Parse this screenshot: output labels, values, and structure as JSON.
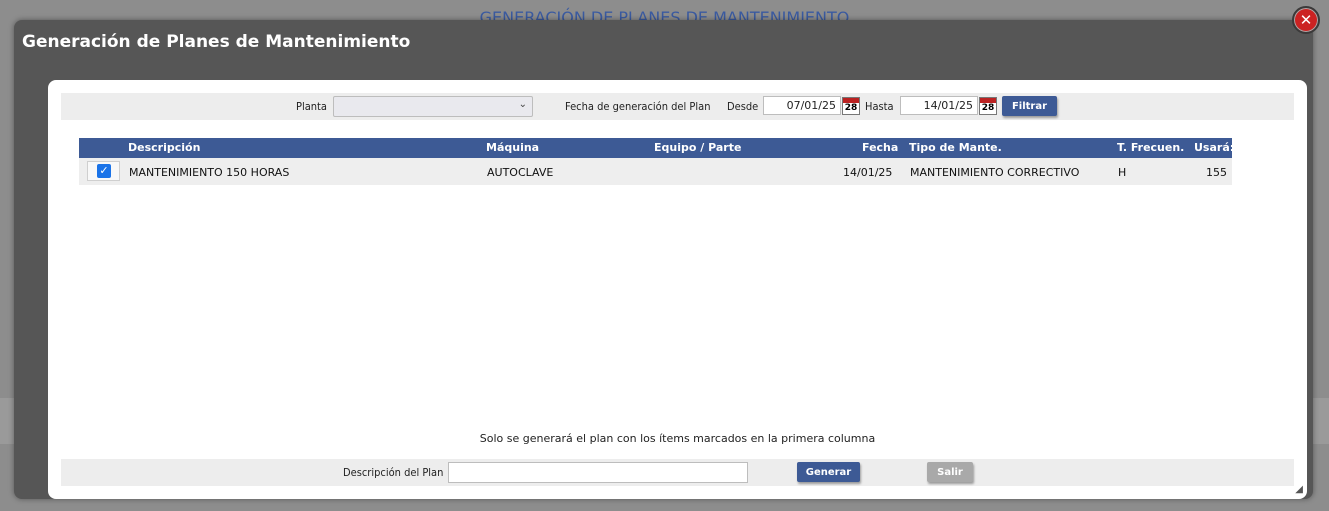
{
  "background": {
    "title": "GENERACIÓN DE PLANES DE MANTENIMIENTO"
  },
  "dialog": {
    "title": "Generación de Planes de Mantenimiento",
    "close_icon": "close-icon",
    "close_symbol": "✕"
  },
  "filters": {
    "planta_label": "Planta",
    "planta_value": "",
    "fecha_label": "Fecha de generación del Plan",
    "desde_label": "Desde",
    "desde_value": "07/01/25",
    "hasta_label": "Hasta",
    "hasta_value": "14/01/25",
    "calendar_icon": "calendar-icon",
    "calendar_day": "28",
    "filtrar_label": "Filtrar"
  },
  "table": {
    "headers": {
      "descripcion": "Descripción",
      "maquina": "Máquina",
      "equipo": "Equipo / Parte",
      "fecha": "Fecha",
      "tipo": "Tipo de Mante.",
      "frecuencia": "T. Frecuen.",
      "usara": "Usará:"
    },
    "rows": [
      {
        "checked": true,
        "descripcion": "MANTENIMIENTO 150 HORAS",
        "maquina": "AUTOCLAVE",
        "equipo": "",
        "fecha": "14/01/25",
        "tipo": "MANTENIMIENTO CORRECTIVO",
        "frecuencia": "H",
        "usara": "155"
      }
    ]
  },
  "note": "Solo se generará el plan con los ítems marcados en la primera columna",
  "footer": {
    "descripcion_label": "Descripción del Plan",
    "descripcion_value": "",
    "generar_label": "Generar",
    "salir_label": "Salir"
  },
  "colors": {
    "header_blue": "#3d5a95",
    "close_red": "#cc2222",
    "checkbox_blue": "#1a73e8"
  }
}
